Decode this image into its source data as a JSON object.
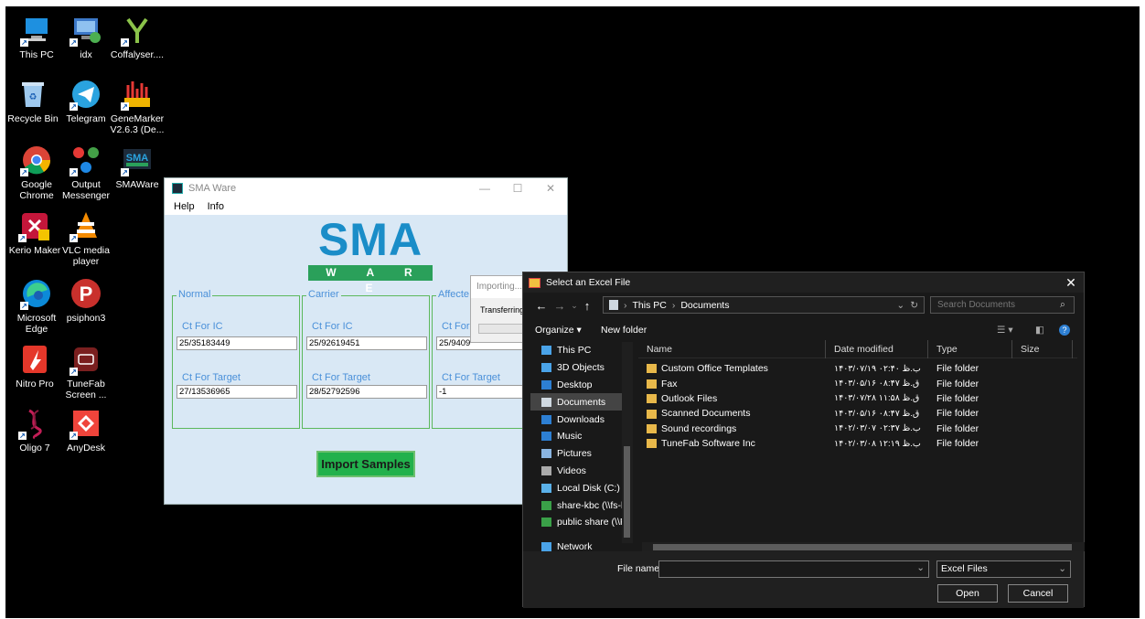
{
  "desktop": {
    "icons": [
      {
        "label": "This PC",
        "icon": "computer-icon"
      },
      {
        "label": "idx",
        "icon": "network-monitor-icon"
      },
      {
        "label": "Coffalyser....",
        "icon": "coffalyser-icon"
      },
      {
        "label": "Recycle Bin",
        "icon": "recycle-bin-icon"
      },
      {
        "label": "Telegram",
        "icon": "telegram-icon"
      },
      {
        "label": "GeneMarker V2.6.3 (De...",
        "icon": "genemarker-icon"
      },
      {
        "label": "Google Chrome",
        "icon": "chrome-icon"
      },
      {
        "label": "Output Messenger",
        "icon": "output-messenger-icon"
      },
      {
        "label": "SMAWare",
        "icon": "smaware-icon"
      },
      {
        "label": "Kerio Maker",
        "icon": "kerio-icon"
      },
      {
        "label": "VLC media player",
        "icon": "vlc-icon"
      },
      {
        "label": "Microsoft Edge",
        "icon": "edge-icon"
      },
      {
        "label": "psiphon3",
        "icon": "psiphon-icon"
      },
      {
        "label": "Nitro Pro",
        "icon": "nitro-icon"
      },
      {
        "label": "TuneFab Screen ...",
        "icon": "tunefab-icon"
      },
      {
        "label": "Oligo 7",
        "icon": "oligo-icon"
      },
      {
        "label": "AnyDesk",
        "icon": "anydesk-icon"
      }
    ]
  },
  "sma": {
    "title": "SMA Ware",
    "menu": [
      "Help",
      "Info"
    ],
    "logo": "SMA",
    "logo_sub": "W A R E",
    "groups": [
      {
        "title": "Normal",
        "ic_label": "Ct For IC",
        "ic_value": "25/35183449",
        "target_label": "Ct For Target",
        "target_value": "27/13536965"
      },
      {
        "title": "Carrier",
        "ic_label": "Ct For IC",
        "ic_value": "25/92619451",
        "target_label": "Ct For Target",
        "target_value": "28/52792596"
      },
      {
        "title": "Affecte",
        "ic_label": "Ct For",
        "ic_value": "25/9409",
        "target_label": "Ct For Target",
        "target_value": "-1"
      }
    ],
    "import_button": "Import Samples"
  },
  "progress": {
    "title": "Importing...",
    "message": "Transferring"
  },
  "dialog": {
    "title": "Select an Excel File",
    "path": [
      "This PC",
      "Documents"
    ],
    "search_placeholder": "Search Documents",
    "organize": "Organize ▾",
    "new_folder": "New folder",
    "nav": [
      {
        "label": "This PC",
        "icon": "this-pc-icon",
        "color": "#4aa3e8"
      },
      {
        "label": "3D Objects",
        "icon": "3d-objects-icon",
        "color": "#4aa3e8"
      },
      {
        "label": "Desktop",
        "icon": "desktop-icon",
        "color": "#2d7fd3"
      },
      {
        "label": "Documents",
        "icon": "documents-icon",
        "color": "#cfd8e0"
      },
      {
        "label": "Downloads",
        "icon": "downloads-icon",
        "color": "#2d7fd3"
      },
      {
        "label": "Music",
        "icon": "music-icon",
        "color": "#2d7fd3"
      },
      {
        "label": "Pictures",
        "icon": "pictures-icon",
        "color": "#8ab4e0"
      },
      {
        "label": "Videos",
        "icon": "videos-icon",
        "color": "#aaaaaa"
      },
      {
        "label": "Local Disk (C:)",
        "icon": "disk-icon",
        "color": "#5ab0e8"
      },
      {
        "label": "share-kbc (\\\\fs-l",
        "icon": "network-drive-icon",
        "color": "#3aa048"
      },
      {
        "label": "public share (\\\\F",
        "icon": "network-drive-icon",
        "color": "#3aa048"
      },
      {
        "label": "Network",
        "icon": "network-icon",
        "color": "#4aa3e8"
      }
    ],
    "columns": [
      "Name",
      "Date modified",
      "Type",
      "Size"
    ],
    "files": [
      {
        "name": "Custom Office Templates",
        "date": "۱۴۰۳/۰۷/۱۹ ب.ظ ۰۲:۴۰",
        "type": "File folder"
      },
      {
        "name": "Fax",
        "date": "۱۴۰۳/۰۵/۱۶ ق.ظ ۰۸:۴۷",
        "type": "File folder"
      },
      {
        "name": "Outlook Files",
        "date": "۱۴۰۳/۰۷/۲۸ ق.ظ ۱۱:۵۸",
        "type": "File folder"
      },
      {
        "name": "Scanned Documents",
        "date": "۱۴۰۳/۰۵/۱۶ ق.ظ ۰۸:۴۷",
        "type": "File folder"
      },
      {
        "name": "Sound recordings",
        "date": "۱۴۰۲/۰۳/۰۷ ب.ظ ۰۲:۳۷",
        "type": "File folder"
      },
      {
        "name": "TuneFab Software Inc",
        "date": "۱۴۰۲/۰۳/۰۸ ب.ظ ۱۲:۱۹",
        "type": "File folder"
      }
    ],
    "filename_label": "File name:",
    "filename_value": "",
    "filetype": "Excel Files",
    "open_button": "Open",
    "cancel_button": "Cancel"
  }
}
